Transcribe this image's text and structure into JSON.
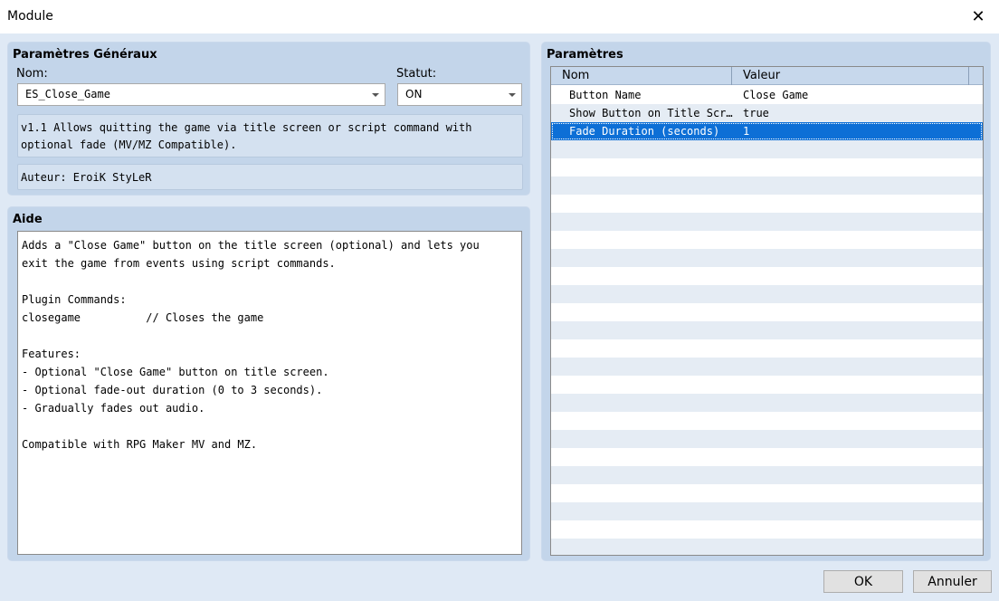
{
  "window": {
    "title": "Module"
  },
  "general": {
    "title": "Paramètres Généraux",
    "name_label": "Nom:",
    "name_value": "ES_Close_Game",
    "status_label": "Statut:",
    "status_value": "ON",
    "description": "v1.1 Allows quitting the game via title screen or script command with optional fade (MV/MZ Compatible).",
    "author": "Auteur: EroiK StyLeR"
  },
  "help": {
    "title": "Aide",
    "text": "Adds a \"Close Game\" button on the title screen (optional) and lets you\nexit the game from events using script commands.\n\nPlugin Commands:\nclosegame          // Closes the game\n\nFeatures:\n- Optional \"Close Game\" button on title screen.\n- Optional fade-out duration (0 to 3 seconds).\n- Gradually fades out audio.\n\nCompatible with RPG Maker MV and MZ."
  },
  "params": {
    "title": "Paramètres",
    "columns": [
      "Nom",
      "Valeur"
    ],
    "rows": [
      {
        "name": "Button Name",
        "value": "Close Game"
      },
      {
        "name": "Show Button on Title Scr…",
        "value": "true"
      },
      {
        "name": "Fade Duration (seconds)",
        "value": "1"
      }
    ]
  },
  "buttons": {
    "ok": "OK",
    "cancel": "Annuler"
  }
}
